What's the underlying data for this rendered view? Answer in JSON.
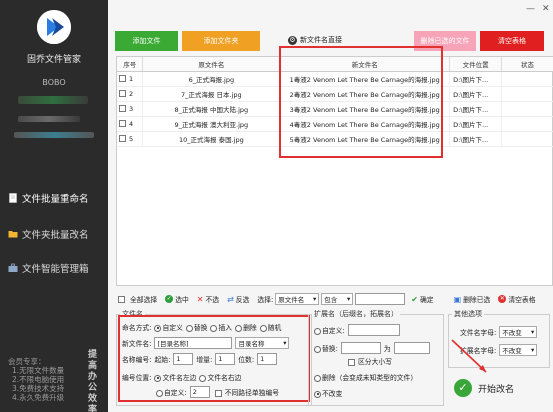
{
  "sidebar": {
    "app_name": "固乔文件管家",
    "user_name": "BOBO",
    "nav": [
      {
        "label": "文件批量重命名",
        "icon": "document-icon"
      },
      {
        "label": "文件夹批量改名",
        "icon": "folder-icon"
      },
      {
        "label": "文件智能管理箱",
        "icon": "toolbox-icon"
      }
    ],
    "promo_title": "会员专享：",
    "promo_items": [
      "1.无限文件数量",
      "2.不限电脑使用",
      "3.免费技术支持",
      "4.永久免费升级"
    ],
    "promo_vertical": "提高办公效率"
  },
  "window": {
    "minimize": "—",
    "close": "✕"
  },
  "toolbar": {
    "add_file": "添加文件",
    "add_folder": "添加文件夹",
    "new_name_replace": "新文件名直接",
    "delete_selected": "删除已选的文件",
    "clear_table": "清空表格"
  },
  "table": {
    "headers": [
      "序号",
      "原文件名",
      "新文件名",
      "文件位置",
      "状态"
    ],
    "rows": [
      {
        "no": "1",
        "orig": "6_正式海报.jpg",
        "new": "1毒液2 Venom Let There Be Carnage的海报.jpg",
        "path": "D:\\图片下..."
      },
      {
        "no": "2",
        "orig": "7_正式海报 日本.jpg",
        "new": "2毒液2 Venom Let There Be Carnage的海报.jpg",
        "path": "D:\\图片下..."
      },
      {
        "no": "3",
        "orig": "8_正式海报 中国大陆.jpg",
        "new": "3毒液2 Venom Let There Be Carnage的海报.jpg",
        "path": "D:\\图片下..."
      },
      {
        "no": "4",
        "orig": "9_正式海报 澳大利亚.jpg",
        "new": "4毒液2 Venom Let There Be Carnage的海报.jpg",
        "path": "D:\\图片下..."
      },
      {
        "no": "5",
        "orig": "10_正式海报 泰国.jpg",
        "new": "5毒液2 Venom Let There Be Carnage的海报.jpg",
        "path": "D:\\图片下..."
      }
    ]
  },
  "actions": {
    "select_all": "全部选择",
    "select": "选中",
    "deselect": "不选",
    "invert": "反选",
    "choose_label": "选择:",
    "filter_field": "原文件名",
    "filter_op": "包含",
    "confirm": "确定",
    "delete_selected": "删除已选",
    "clear_table": "清空表格"
  },
  "filename_panel": {
    "title": "文件名",
    "mode_label": "命名方式:",
    "modes": [
      "自定义",
      "替换",
      "插入",
      "删除",
      "随机"
    ],
    "new_name_label": "新文件名:",
    "new_name_value": "[目录名称]",
    "new_name_select": "目录名称",
    "numbering_label": "名称编号:",
    "start_label": "起始:",
    "start_value": "1",
    "step_label": "增量:",
    "step_value": "1",
    "digits_label": "位数:",
    "digits_value": "1",
    "position_label": "编号位置:",
    "pos_left": "文件名左边",
    "pos_right": "文件名右边",
    "pos_custom": "自定义:",
    "custom_value": "2",
    "per_path": "不同路径单独编号"
  },
  "ext_panel": {
    "title": "扩展名（后缀名，拓展名）",
    "custom": "自定义:",
    "replace": "替换:",
    "to": "为",
    "case": "区分大小写",
    "delete": "删除（会变成未知类型的文件）",
    "unchanged": "不改变"
  },
  "other_panel": {
    "title": "其他选项",
    "name_case_label": "文件名字母:",
    "name_case_value": "不改变",
    "ext_case_label": "扩展名字母:",
    "ext_case_value": "不改变"
  },
  "start_button": "开始改名"
}
